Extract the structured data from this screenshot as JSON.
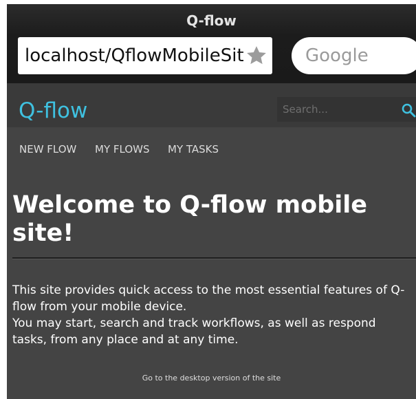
{
  "browser": {
    "title": "Q-flow",
    "url": "localhost/QflowMobileSite",
    "search_engine_placeholder": "Google"
  },
  "header": {
    "logo": "Q-flow",
    "search_placeholder": "Search..."
  },
  "nav": {
    "items": [
      {
        "label": "NEW FLOW"
      },
      {
        "label": "MY FLOWS"
      },
      {
        "label": "MY TASKS"
      }
    ]
  },
  "main": {
    "title": "Welcome to Q-flow mobile site!",
    "intro_line1": "This site provides quick access to the most essential features of Q-flow from your mobile device.",
    "intro_line2": "You may start, search and track workflows, as well as respond tasks, from any place and at any time.",
    "desktop_link": "Go to the desktop version of the site"
  },
  "colors": {
    "accent": "#3fc1e0",
    "background": "#444444",
    "header_background": "#3a3a3a",
    "chrome_background": "#1c1c1c"
  },
  "icons": {
    "bookmark": "star-icon",
    "search": "search-icon"
  }
}
